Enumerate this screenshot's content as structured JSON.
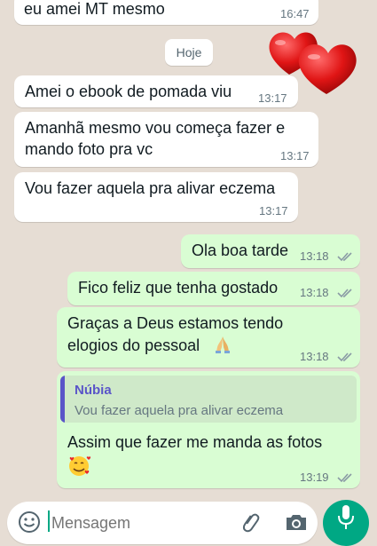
{
  "messages": [
    {
      "id": "m0",
      "text": "eu amei MT mesmo",
      "time": "16:47",
      "dir": "in"
    },
    {
      "id": "m1",
      "text": "Amei o ebook de pomada viu",
      "time": "13:17",
      "dir": "in"
    },
    {
      "id": "m2",
      "line1": "Amanhã mesmo vou começa fazer e",
      "line2": "mando foto pra vc",
      "time": "13:17",
      "dir": "in"
    },
    {
      "id": "m3",
      "text": "Vou fazer aquela pra alivar eczema",
      "time": "13:17",
      "dir": "in"
    },
    {
      "id": "m4",
      "text": "Ola boa tarde",
      "time": "13:18",
      "dir": "out"
    },
    {
      "id": "m5",
      "text": "Fico feliz que tenha gostado",
      "time": "13:18",
      "dir": "out"
    },
    {
      "id": "m6",
      "line1": "Graças a Deus estamos tendo",
      "line2": "elogios do pessoal",
      "emoji": "praying-hands",
      "time": "13:18",
      "dir": "out"
    },
    {
      "id": "m7",
      "quote_name": "Núbia",
      "quote_text": "Vou fazer aquela pra alivar eczema",
      "text": "Assim que fazer me manda as fotos",
      "emoji": "smiling-face-with-hearts",
      "time": "13:19",
      "dir": "out"
    }
  ],
  "date_chip": "Hoje",
  "sticker": "red-hearts-sticker",
  "composer": {
    "placeholder": "Mensagem"
  },
  "colors": {
    "incoming": "#ffffff",
    "outgoing": "#d9fdd3",
    "accent": "#00a884",
    "quote_name": "#5a55c8",
    "read_ticks": "#8a9aa5"
  },
  "icons": [
    "emoji-icon",
    "attach-icon",
    "camera-icon",
    "mic-icon",
    "double-check-icon"
  ]
}
